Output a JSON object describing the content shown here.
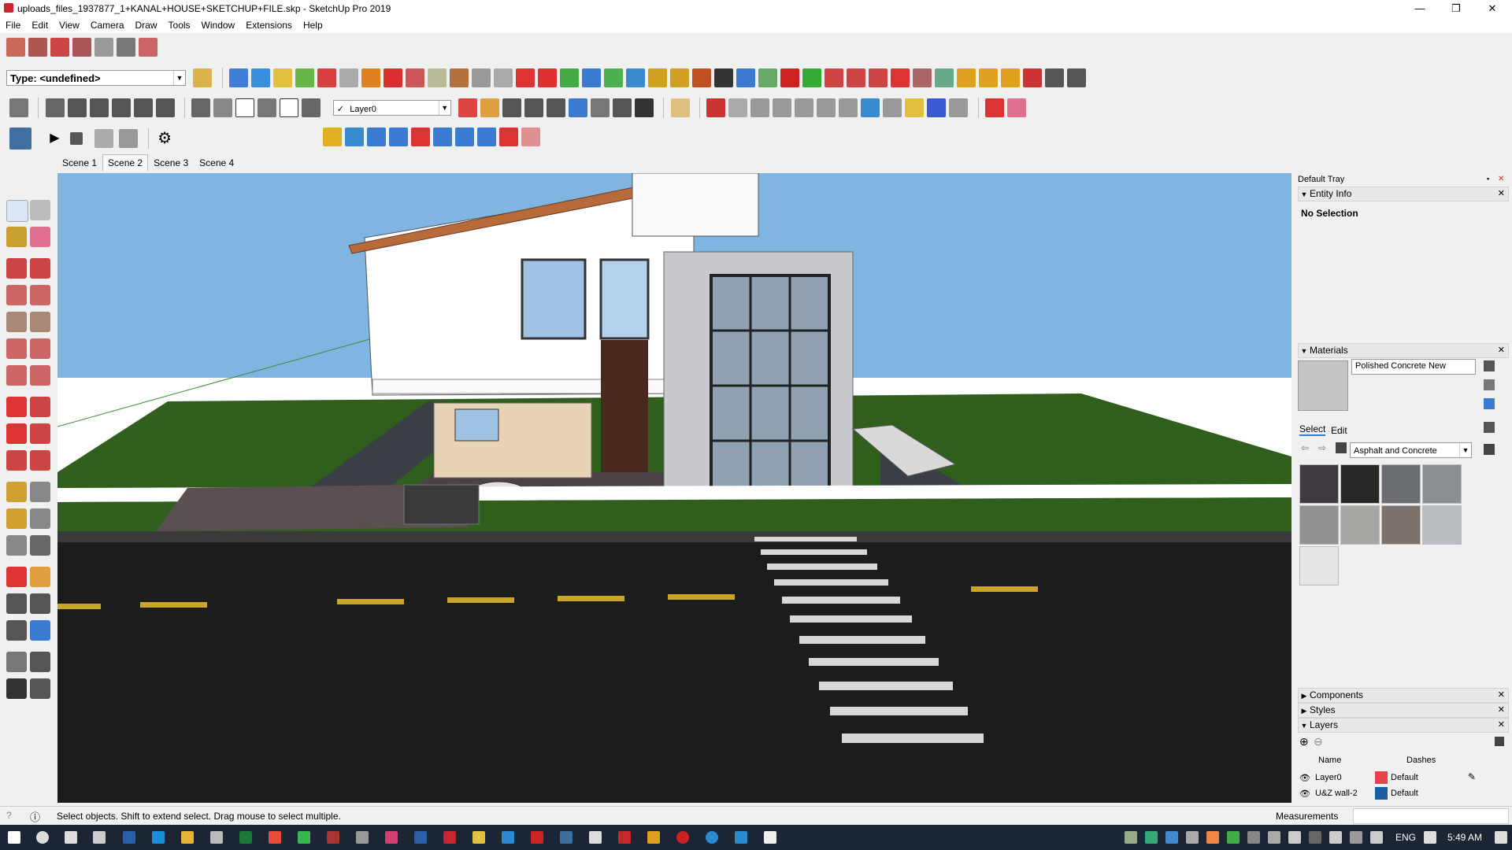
{
  "window": {
    "title": "uploads_files_1937877_1+KANAL+HOUSE+SKETCHUP+FILE.skp - SketchUp Pro 2019",
    "minimize_glyph": "—",
    "restore_glyph": "❐",
    "close_glyph": "✕"
  },
  "menu": [
    "File",
    "Edit",
    "View",
    "Camera",
    "Draw",
    "Tools",
    "Window",
    "Extensions",
    "Help"
  ],
  "type_dropdown": {
    "value": "Type: <undefined>"
  },
  "layer_dropdown": {
    "check": "✓",
    "value": "Layer0"
  },
  "dropdown_arrow": "▼",
  "scenes": [
    "Scene 1",
    "Scene 2",
    "Scene 3",
    "Scene 4"
  ],
  "active_scene": "Scene 2",
  "tray": {
    "title": "Default Tray",
    "pin_glyph": "▪",
    "close_glyph": "✕",
    "entity_info": {
      "header": "Entity Info",
      "status": "No Selection"
    },
    "materials": {
      "header": "Materials",
      "name": "Polished Concrete New",
      "tab_select": "Select",
      "tab_edit": "Edit",
      "library": "Asphalt and Concrete",
      "swatches": [
        "#3e3a40",
        "#262626",
        "#6a6e72",
        "#8c8f92",
        "#939191",
        "#a7a8a3",
        "#7b726c",
        "#b9bcc0",
        "#e6e6e6"
      ]
    },
    "components_header": "Components",
    "styles_header": "Styles",
    "layers": {
      "header": "Layers",
      "col_name": "Name",
      "col_dashes": "Dashes",
      "rows": [
        {
          "name": "Layer0",
          "dashes": "Default",
          "color": "#e5454a"
        },
        {
          "name": "U&Z wall-2",
          "dashes": "Default",
          "color": "#1c5fa0"
        }
      ]
    }
  },
  "status": {
    "hint": "Select objects. Shift to extend select. Drag mouse to select multiple.",
    "measurements_label": "Measurements"
  },
  "taskbar": {
    "language": "ENG",
    "time": "5:49 AM"
  },
  "colors": {
    "sky": "#7fb5e0",
    "ground": "#2f5e1d",
    "road": "#1c1c1c",
    "accent_red": "#c8262e"
  }
}
